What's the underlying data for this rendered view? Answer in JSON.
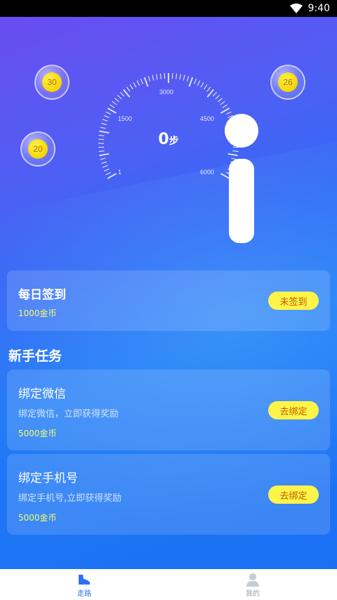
{
  "status_bar": {
    "time": "9:40"
  },
  "bubbles": [
    {
      "value": "30"
    },
    {
      "value": "20"
    },
    {
      "value": "26"
    }
  ],
  "gauge": {
    "steps": "0",
    "unit": "步",
    "ticks": [
      "1",
      "1500",
      "3000",
      "4500",
      "6000"
    ]
  },
  "daily_checkin": {
    "title": "每日签到",
    "reward": "1000金币",
    "button": "未签到"
  },
  "newbie": {
    "section_title": "新手任务",
    "tasks": [
      {
        "title": "绑定微信",
        "desc": "绑定微信，立即获得奖励",
        "reward": "5000金币",
        "button": "去绑定"
      },
      {
        "title": "绑定手机号",
        "desc": "绑定手机号,立即获得奖励",
        "reward": "5000金币",
        "button": "去绑定"
      }
    ]
  },
  "bottom_nav": {
    "items": [
      {
        "label": "走路",
        "icon": "shoe-icon",
        "active": true
      },
      {
        "label": "我的",
        "icon": "user-icon",
        "active": false
      }
    ]
  },
  "colors": {
    "accent": "#2a6ff5",
    "button": "#fff44a",
    "reward": "#f6ff6a"
  }
}
